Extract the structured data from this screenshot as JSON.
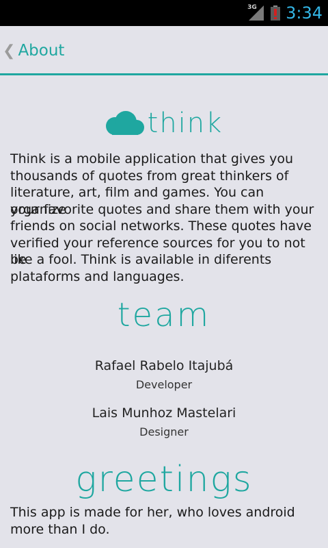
{
  "status_bar": {
    "network": "3G",
    "time": "3:34"
  },
  "action_bar": {
    "title": "About",
    "back_icon": "chevron-left-icon"
  },
  "colors": {
    "accent": "#1fa7a0",
    "background": "#e3e3ea",
    "clock": "#33b5e5"
  },
  "about": {
    "logo_text": "think",
    "description": [
      "Think is a mobile application that gives you",
      "thousands of quotes from great thinkers of",
      "literature, art, film and games. You can organize",
      "your favorite quotes and share them with your",
      "friends on social networks. These quotes have",
      "verified your reference sources for you to not be",
      "like a fool. Think is available in diferents",
      "plataforms and languages."
    ]
  },
  "team": {
    "heading": "team",
    "members": [
      {
        "name": "Rafael Rabelo Itajubá",
        "role": "Developer"
      },
      {
        "name": "Lais Munhoz Mastelari",
        "role": "Designer"
      }
    ]
  },
  "greetings": {
    "heading": "greetings",
    "text": [
      "This app is made for her, who loves android",
      "more than I do."
    ]
  }
}
